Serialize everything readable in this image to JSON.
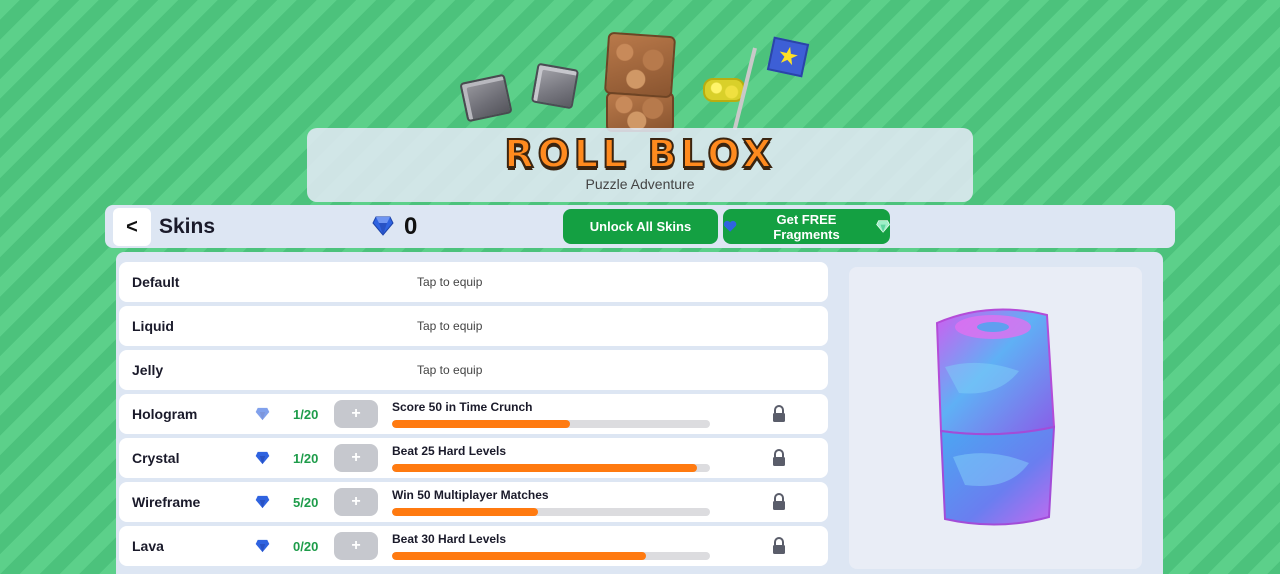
{
  "header": {
    "title": "ROLL BLOX",
    "subtitle": "Puzzle Adventure"
  },
  "topbar": {
    "back_label": "<",
    "title": "Skins",
    "gem_count": "0",
    "unlock_label": "Unlock All Skins",
    "free_label": "Get FREE Fragments"
  },
  "skins": [
    {
      "name": "Default",
      "status": "Tap to equip"
    },
    {
      "name": "Liquid",
      "status": "Tap to equip"
    },
    {
      "name": "Jelly",
      "status": "Tap to equip"
    },
    {
      "name": "Hologram",
      "fragments": "1/20",
      "plus": "+",
      "quest": "Score 50 in Time Crunch",
      "progress": 0.56
    },
    {
      "name": "Crystal",
      "fragments": "1/20",
      "plus": "+",
      "quest": "Beat 25 Hard Levels",
      "progress": 0.96
    },
    {
      "name": "Wireframe",
      "fragments": "5/20",
      "plus": "+",
      "quest": "Win 50 Multiplayer Matches",
      "progress": 0.46
    },
    {
      "name": "Lava",
      "fragments": "0/20",
      "plus": "+",
      "quest": "Beat 30 Hard Levels",
      "progress": 0.8
    }
  ],
  "colors": {
    "accent_green": "#14a042",
    "progress_orange": "#ff7a10",
    "gem_blue": "#2f63e0"
  }
}
